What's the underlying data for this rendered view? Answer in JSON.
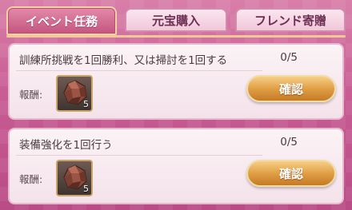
{
  "tabs": [
    {
      "label": "イベント任務",
      "active": true
    },
    {
      "label": "元宝購入",
      "active": false
    },
    {
      "label": "フレンド寄贈",
      "active": false
    }
  ],
  "missions": [
    {
      "title": "訓練所挑戦を1回勝利、又は掃討を1回する",
      "progress": "0/5",
      "reward_label": "報酬:",
      "reward_item_icon": "ore-gem-icon",
      "reward_qty": "5",
      "button_label": "確認"
    },
    {
      "title": "装備強化を1回行う",
      "progress": "0/5",
      "reward_label": "報酬:",
      "reward_item_icon": "ore-gem-icon",
      "reward_qty": "5",
      "button_label": "確認"
    }
  ],
  "colors": {
    "background": "#c85c93",
    "active_tab": "#c4557f",
    "button": "#e09f45"
  }
}
